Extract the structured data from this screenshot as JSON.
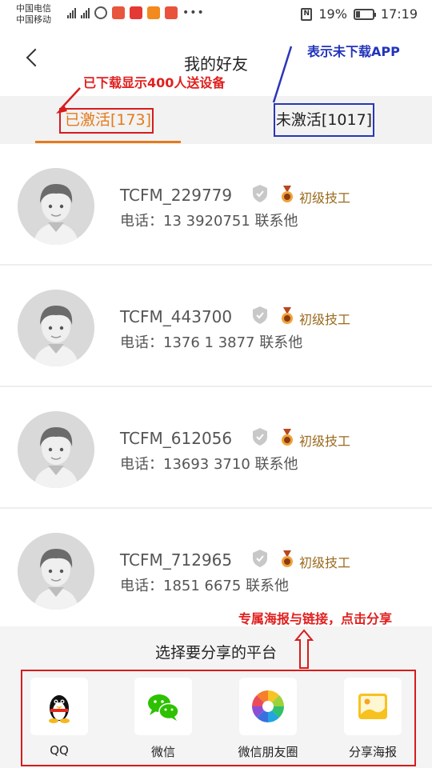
{
  "status_bar": {
    "carrier_1": "中国电信",
    "carrier_2": "中国移动",
    "battery": "19%",
    "time": "17:19"
  },
  "header": {
    "title": "我的好友"
  },
  "tabs": [
    {
      "label": "已激活[173]",
      "active": true
    },
    {
      "label": "未激活[1017]",
      "active": false
    }
  ],
  "friends": [
    {
      "name": "TCFM_229779",
      "level": "初级技工",
      "phone": "电话：13   3920751 联系他"
    },
    {
      "name": "TCFM_443700",
      "level": "初级技工",
      "phone": "电话：1376  1 3877 联系他"
    },
    {
      "name": "TCFM_612056",
      "level": "初级技工",
      "phone": "电话：13693  3710 联系他"
    },
    {
      "name": "TCFM_712965",
      "level": "初级技工",
      "phone": "电话：1851   6675 联系他"
    }
  ],
  "share": {
    "title": "选择要分享的平台",
    "items": [
      {
        "label": "QQ",
        "icon": "qq-penguin-icon"
      },
      {
        "label": "微信",
        "icon": "wechat-icon"
      },
      {
        "label": "微信朋友圈",
        "icon": "moments-aperture-icon"
      },
      {
        "label": "分享海报",
        "icon": "poster-image-icon"
      }
    ]
  },
  "annotations": {
    "downloaded_note": "已下载显示400人送设备",
    "not_downloaded_note": "表示未下载APP",
    "share_note": "专属海报与链接，点击分享",
    "red": "#e0201f",
    "blue": "#2233bb"
  },
  "colors": {
    "accent": "#e57a1b",
    "level_text": "#9a6a1d"
  }
}
